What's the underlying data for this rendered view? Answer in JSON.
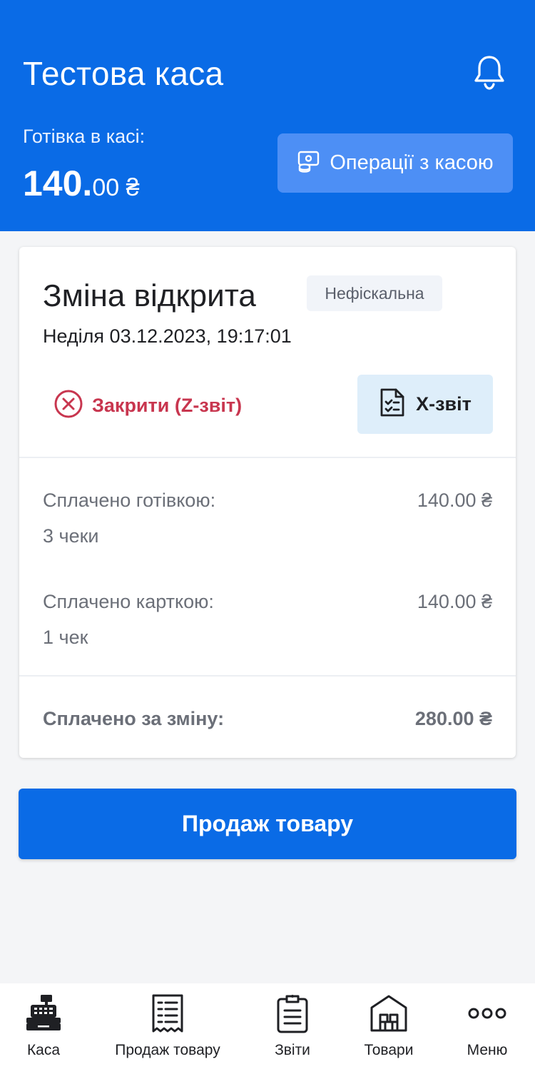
{
  "header": {
    "title": "Тестова каса",
    "cash_label": "Готівка в касі:",
    "cash_int": "140.",
    "cash_dec": "00 ₴",
    "operations_button": "Операції з касою",
    "bell_icon": "bell-icon",
    "operations_icon": "cash-operations-icon"
  },
  "shift": {
    "title": "Зміна відкрита",
    "badge": "Нефіскальна",
    "datetime": "Неділя 03.12.2023, 19:17:01",
    "close_button": "Закрити (Z-звіт)",
    "x_report_button": "X-звіт",
    "close_icon": "close-circle-icon",
    "report_icon": "document-check-icon"
  },
  "payments": {
    "cash_label": "Сплачено готівкою:",
    "cash_value": "140.00 ₴",
    "cash_count": "3 чеки",
    "card_label": "Сплачено карткою:",
    "card_value": "140.00 ₴",
    "card_count": "1 чек",
    "total_label": "Сплачено за зміну:",
    "total_value": "280.00 ₴"
  },
  "sell_button": "Продаж товару",
  "nav": {
    "items": [
      {
        "label": "Каса",
        "icon": "cash-register-icon",
        "active": true
      },
      {
        "label": "Продаж товару",
        "icon": "receipt-icon",
        "active": false
      },
      {
        "label": "Звіти",
        "icon": "clipboard-icon",
        "active": false
      },
      {
        "label": "Товари",
        "icon": "warehouse-icon",
        "active": false
      },
      {
        "label": "Меню",
        "icon": "more-dots-icon",
        "active": false
      }
    ]
  },
  "colors": {
    "primary": "#0a6be6",
    "secondary_button": "#4d8ff5",
    "danger": "#c8364f",
    "x_report_bg": "#deeefa",
    "badge_bg": "#f1f4f9"
  }
}
